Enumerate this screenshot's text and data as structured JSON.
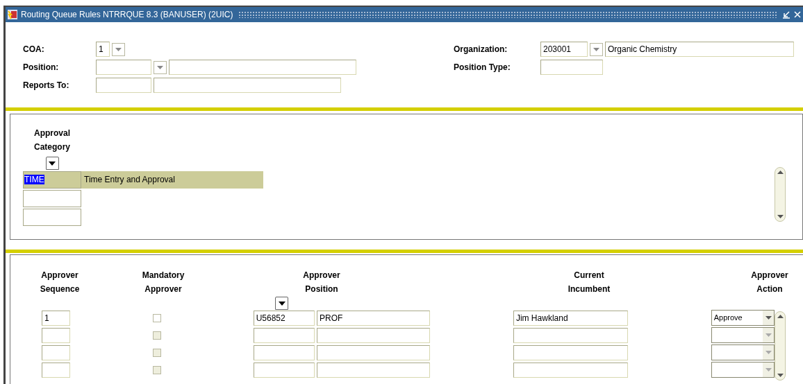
{
  "window": {
    "title": "Routing Queue Rules  NTRRQUE  8.3  (BANUSER)  (2UIC)"
  },
  "header": {
    "coa": {
      "label": "COA:",
      "value": "1"
    },
    "position": {
      "label": "Position:"
    },
    "reports_to": {
      "label": "Reports To:"
    },
    "organization": {
      "label": "Organization:",
      "code": "203001",
      "description": "Organic Chemistry"
    },
    "position_type": {
      "label": "Position Type:"
    }
  },
  "approval_category": {
    "heading": [
      "Approval",
      "Category"
    ],
    "rows": [
      {
        "code": "TIME",
        "description": "Time Entry and Approval",
        "selected": true
      },
      {
        "selected": false
      },
      {
        "selected": false
      }
    ]
  },
  "approvers": {
    "columns": [
      [
        "Approver",
        "Sequence"
      ],
      [
        "Mandatory",
        "Approver"
      ],
      [
        "Approver",
        "Position"
      ],
      [
        "Current",
        "Incumbent"
      ],
      [
        "Approver",
        "Action"
      ]
    ],
    "rows": [
      {
        "sequence": "1",
        "mandatory": false,
        "disabled": false,
        "position_code": "U56852",
        "position_title": "PROF",
        "incumbent": "Jim Hawkland",
        "action": "Approve"
      },
      {
        "mandatory": false,
        "disabled": true
      },
      {
        "mandatory": false,
        "disabled": true
      },
      {
        "mandatory": false,
        "disabled": true
      }
    ]
  }
}
